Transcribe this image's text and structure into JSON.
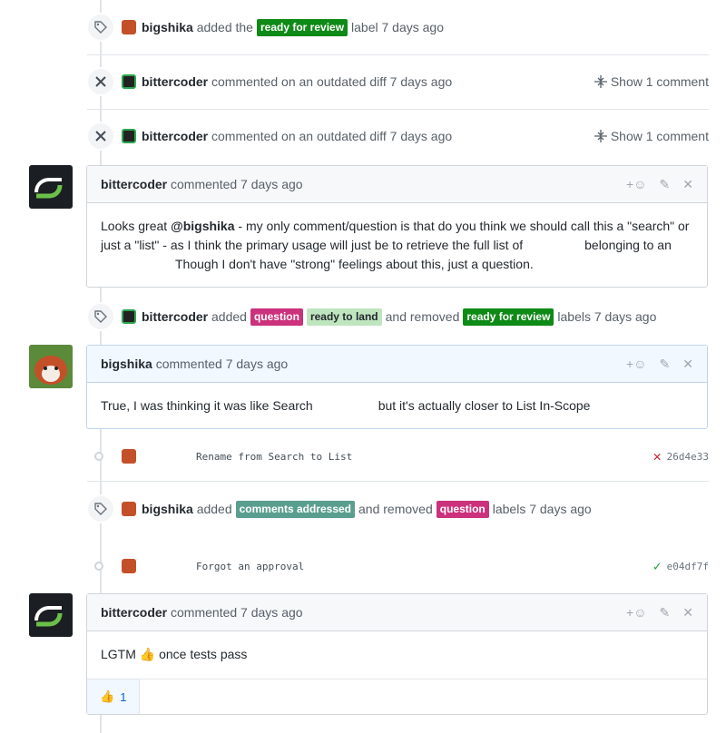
{
  "events": [
    {
      "actor": "bigshika",
      "pre": "added the",
      "labels": [
        {
          "text": "ready for review",
          "bg": "#0e8a16",
          "fg": "#ffffff"
        }
      ],
      "post": "label 7 days ago"
    },
    {
      "actor": "bittercoder",
      "text": "commented on an outdated diff 7 days ago",
      "show": "Show 1 comment"
    },
    {
      "actor": "bittercoder",
      "text": "commented on an outdated diff 7 days ago",
      "show": "Show 1 comment"
    },
    {
      "actor": "bittercoder",
      "pre": "added",
      "labels": [
        {
          "text": "question",
          "bg": "#cc317c",
          "fg": "#ffffff"
        },
        {
          "text": "ready to land",
          "bg": "#bfe5bf",
          "fg": "#24292e"
        }
      ],
      "mid": "and removed",
      "labels2": [
        {
          "text": "ready for review",
          "bg": "#0e8a16",
          "fg": "#ffffff"
        }
      ],
      "post": "labels 7 days ago"
    },
    {
      "actor": "bigshika",
      "pre": "added",
      "labels": [
        {
          "text": "comments addressed",
          "bg": "#5a9e8f",
          "fg": "#ffffff"
        }
      ],
      "mid": "and removed",
      "labels2": [
        {
          "text": "question",
          "bg": "#cc317c",
          "fg": "#ffffff"
        }
      ],
      "post": "labels 7 days ago"
    }
  ],
  "comments": [
    {
      "author": "bittercoder",
      "meta": "commented 7 days ago",
      "line1_pre": "Looks great ",
      "mention": "@bigshika",
      "line1_post": " - my only comment/question is that do you think we should call this a \"search\" or",
      "line2_pre": "just a \"list\" - as I think the primary usage will just be to retrieve the full list of",
      "line2_post": "belonging to an",
      "line3": "Though I don't have \"strong\" feelings about this, just a question."
    },
    {
      "author": "bigshika",
      "meta": "commented 7 days ago",
      "body_pre": "True, I was thinking it was like Search",
      "body_post": "but it's actually closer to List In-Scope"
    },
    {
      "author": "bittercoder",
      "meta": "commented 7 days ago",
      "body_pre": "LGTM",
      "emoji": "👍",
      "body_post": "once tests pass",
      "reaction_emoji": "👍",
      "reaction_count": "1"
    }
  ],
  "commits": [
    {
      "message": "Rename from Search to List",
      "sha": "26d4e33",
      "status": "fail",
      "status_color": "#cb2431"
    },
    {
      "message": "Forgot an approval",
      "sha": "e04df7f",
      "status": "success",
      "status_color": "#28a745"
    }
  ],
  "icons": {
    "tag": "tag-icon",
    "close": "close-icon",
    "unfold": "unfold-icon",
    "smiley": "add-reaction-icon",
    "pencil": "edit-icon",
    "x": "delete-icon"
  }
}
